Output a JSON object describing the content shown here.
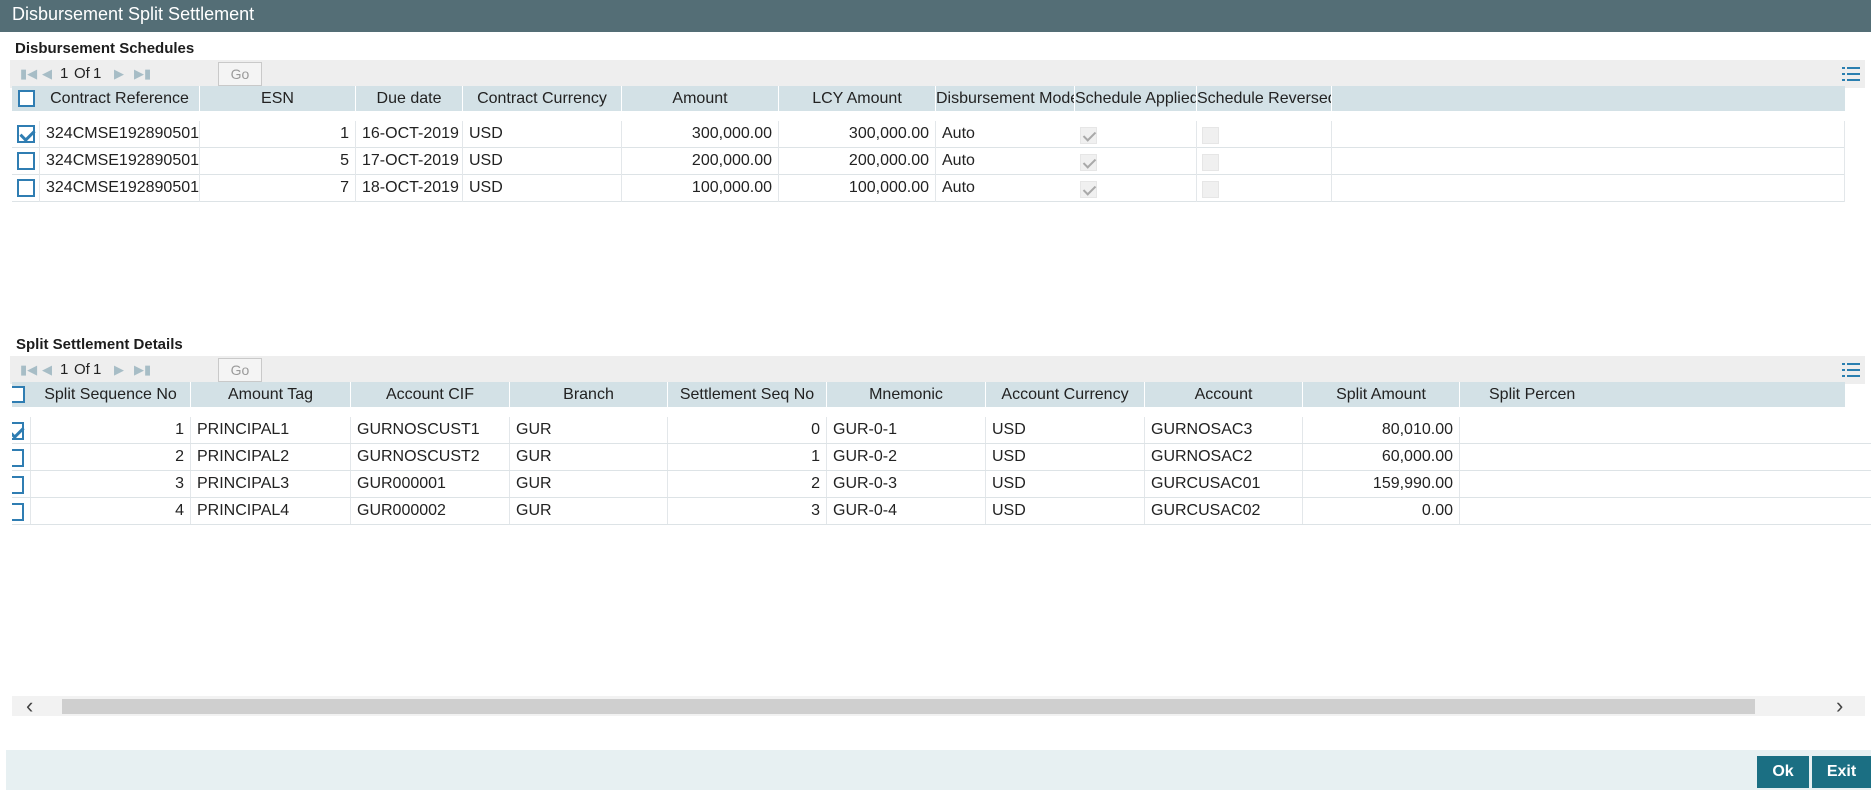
{
  "window": {
    "title": "Disbursement Split Settlement"
  },
  "schedules": {
    "title": "Disbursement Schedules",
    "pager": {
      "current": "1",
      "of_label": "Of",
      "total": "1",
      "go_label": "Go"
    },
    "columns": [
      "Contract Reference",
      "ESN",
      "Due date",
      "Contract Currency",
      "Amount",
      "LCY Amount",
      "Disbursement Mode",
      "Schedule Applied",
      "Schedule Reversed"
    ],
    "rows": [
      {
        "selected": true,
        "contract_reference": "324CMSE192890501",
        "esn": "1",
        "due_date": "16-OCT-2019",
        "currency": "USD",
        "amount": "300,000.00",
        "lcy_amount": "300,000.00",
        "mode": "Auto",
        "schedule_applied": true,
        "schedule_reversed": false
      },
      {
        "selected": false,
        "contract_reference": "324CMSE192890501",
        "esn": "5",
        "due_date": "17-OCT-2019",
        "currency": "USD",
        "amount": "200,000.00",
        "lcy_amount": "200,000.00",
        "mode": "Auto",
        "schedule_applied": true,
        "schedule_reversed": false
      },
      {
        "selected": false,
        "contract_reference": "324CMSE192890501",
        "esn": "7",
        "due_date": "18-OCT-2019",
        "currency": "USD",
        "amount": "100,000.00",
        "lcy_amount": "100,000.00",
        "mode": "Auto",
        "schedule_applied": true,
        "schedule_reversed": false
      }
    ]
  },
  "split": {
    "title": "Split Settlement Details",
    "pager": {
      "current": "1",
      "of_label": "Of",
      "total": "1",
      "go_label": "Go"
    },
    "columns": [
      "Split Sequence No",
      "Amount Tag",
      "Account CIF",
      "Branch",
      "Settlement Seq No",
      "Mnemonic",
      "Account Currency",
      "Account",
      "Split Amount",
      "Split Percen"
    ],
    "rows": [
      {
        "selected": true,
        "seq": "1",
        "amount_tag": "PRINCIPAL1",
        "account_cif": "GURNOSCUST1",
        "branch": "GUR",
        "settlement_seq": "0",
        "mnemonic": "GUR-0-1",
        "currency": "USD",
        "account": "GURNOSAC3",
        "split_amount": "80,010.00"
      },
      {
        "selected": false,
        "seq": "2",
        "amount_tag": "PRINCIPAL2",
        "account_cif": "GURNOSCUST2",
        "branch": "GUR",
        "settlement_seq": "1",
        "mnemonic": "GUR-0-2",
        "currency": "USD",
        "account": "GURNOSAC2",
        "split_amount": "60,000.00"
      },
      {
        "selected": false,
        "seq": "3",
        "amount_tag": "PRINCIPAL3",
        "account_cif": "GUR000001",
        "branch": "GUR",
        "settlement_seq": "2",
        "mnemonic": "GUR-0-3",
        "currency": "USD",
        "account": "GURCUSAC01",
        "split_amount": "159,990.00"
      },
      {
        "selected": false,
        "seq": "4",
        "amount_tag": "PRINCIPAL4",
        "account_cif": "GUR000002",
        "branch": "GUR",
        "settlement_seq": "3",
        "mnemonic": "GUR-0-4",
        "currency": "USD",
        "account": "GURCUSAC02",
        "split_amount": "0.00"
      }
    ]
  },
  "buttons": {
    "ok": "Ok",
    "exit": "Exit"
  },
  "icons": {
    "first": "first-page-icon",
    "prev": "previous-page-icon",
    "next": "next-page-icon",
    "last": "last-page-icon",
    "list_view": "list-view-icon",
    "scroll_left": "scroll-left-icon",
    "scroll_right": "scroll-right-icon"
  },
  "colors": {
    "titlebar": "#546e76",
    "grid_header": "#d3e1e6",
    "accent": "#2f7db2",
    "button": "#1b6f83",
    "footer": "#e7f0f2"
  }
}
